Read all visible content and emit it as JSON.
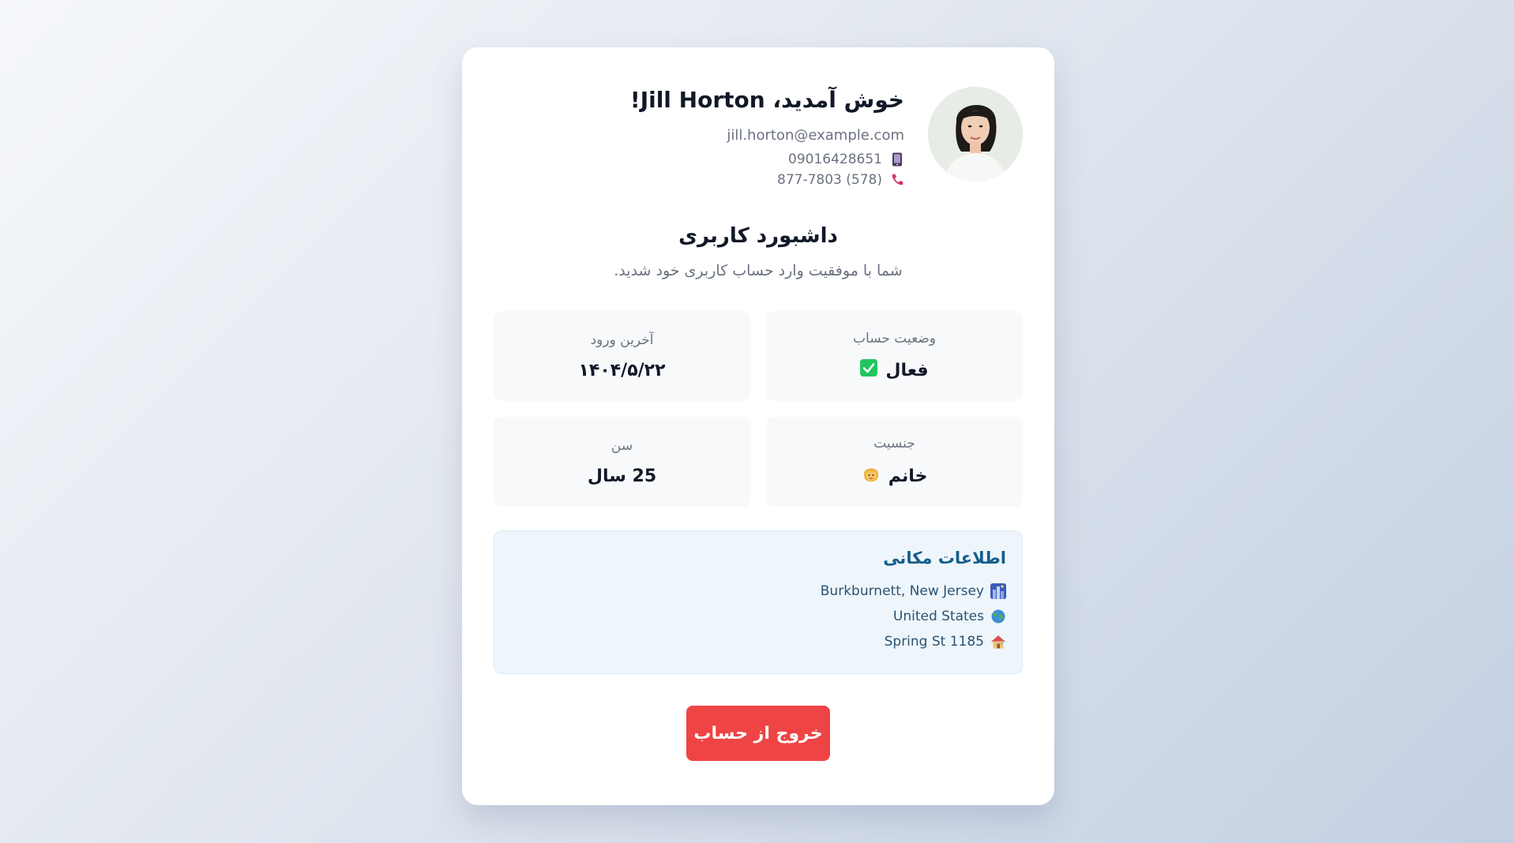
{
  "user": {
    "welcome": "خوش آمدید، Jill Horton!",
    "email": "jill.horton@example.com",
    "cell": "09016428651",
    "phone": "(578) 877-7803"
  },
  "icons": {
    "cell": "mobile-phone-icon",
    "phone": "telephone-icon",
    "status": "check-mark-icon",
    "gender": "woman-emoji-icon",
    "city": "cityscape-icon",
    "country": "globe-icon",
    "street": "house-icon"
  },
  "dashboard": {
    "title": "داشبورد کاربری",
    "subtitle": "شما با موفقیت وارد حساب کاربری خود شدید."
  },
  "stats": {
    "status_label": "وضعیت حساب",
    "status_value": "فعال",
    "last_login_label": "آخرین ورود",
    "last_login_value": "۱۴۰۴/۵/۲۲",
    "gender_label": "جنسیت",
    "gender_value": "خانم",
    "age_label": "سن",
    "age_value": "25 سال"
  },
  "location": {
    "title": "اطلاعات مکانی",
    "city": "Burkburnett, New Jersey",
    "country": "United States",
    "street": "Spring St 1185"
  },
  "actions": {
    "logout": "خروج از حساب"
  },
  "colors": {
    "accent_red": "#ef4444",
    "location_title": "#155e8c",
    "status_check": "#22c55e"
  }
}
